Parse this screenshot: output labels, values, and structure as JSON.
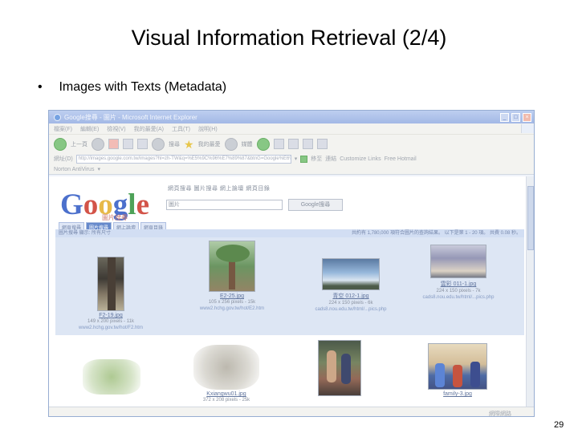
{
  "slide": {
    "title": "Visual Information Retrieval (2/4)",
    "bullet_marker": "•",
    "bullet_text": "Images with Texts (Metadata)",
    "page_number": "29"
  },
  "browser": {
    "window_title": "Google搜尋 - 圖片 - Microsoft Internet Explorer",
    "menu_items": [
      "檔案(F)",
      "編輯(E)",
      "檢視(V)",
      "我的最愛(A)",
      "工具(T)",
      "說明(H)"
    ],
    "toolbar": {
      "back_label": "上一頁",
      "search_label": "搜尋",
      "favorites_label": "我的最愛",
      "media_label": "媒體"
    },
    "address": {
      "label": "網址(D)",
      "value": "http://images.google.com.tw/images?hl=zh-TW&q=%E5%9C%96%E7%89%87&btnG=Google%E6%90%9C%E5%B0%8B",
      "go_label": "移至",
      "links_label": "連結",
      "link_1": "Customize Links",
      "link_2": "Free Hotmail"
    },
    "links_bar": {
      "label": "Norton AntiVirus"
    },
    "status_text": "網際網路"
  },
  "google": {
    "logo_letters": [
      "G",
      "o",
      "o",
      "g",
      "l",
      "e"
    ],
    "logo_colors": [
      "#3d64c8",
      "#d0463a",
      "#e5b43a",
      "#3d64c8",
      "#3f9b4a",
      "#d0463a"
    ],
    "logo_sub": "圖片搜尋",
    "topnav": "網頁搜尋   圖片搜尋   網上論壇   網頁目錄",
    "search_value": "圖片",
    "search_button": "Google搜尋",
    "tabs": [
      "網頁搜尋",
      "圖片搜尋",
      "網上論壇",
      "網頁目錄"
    ],
    "results_left": "圖片搜尋   顯示: 所有尺寸",
    "results_right": "共約有 1,780,000 項符合圖片的查詢結果。  以下是第 1 - 20 項。  共費 0.08 秒。"
  },
  "thumbnails": [
    {
      "name": "F2-19.jpg",
      "meta": "149 x 200 pixels - 11k",
      "url": "www2.hchg.gov.tw/hot/F2.htm"
    },
    {
      "name": "E2-25.jpg",
      "meta": "105 x 256 pixels - 15k",
      "url": "www2.hchg.gov.tw/hot/E2.htm"
    },
    {
      "name": "青空 012-1.jpg",
      "meta": "224 x 150 pixels - 6k",
      "url": "cads8.nou.edu.tw/html/...pics.php"
    },
    {
      "name": "雲彩 011-1.jpg",
      "meta": "224 x 150 pixels - 7k",
      "url": "cads8.nou.edu.tw/html/...pics.php"
    },
    {
      "name": "",
      "meta": "",
      "url": ""
    },
    {
      "name": "Kxiangwu01.jpg",
      "meta": "372 x 208 pixels - 25k",
      "url": ""
    },
    {
      "name": "",
      "meta": "",
      "url": ""
    },
    {
      "name": "family-3.jpg",
      "meta": "",
      "url": ""
    }
  ]
}
